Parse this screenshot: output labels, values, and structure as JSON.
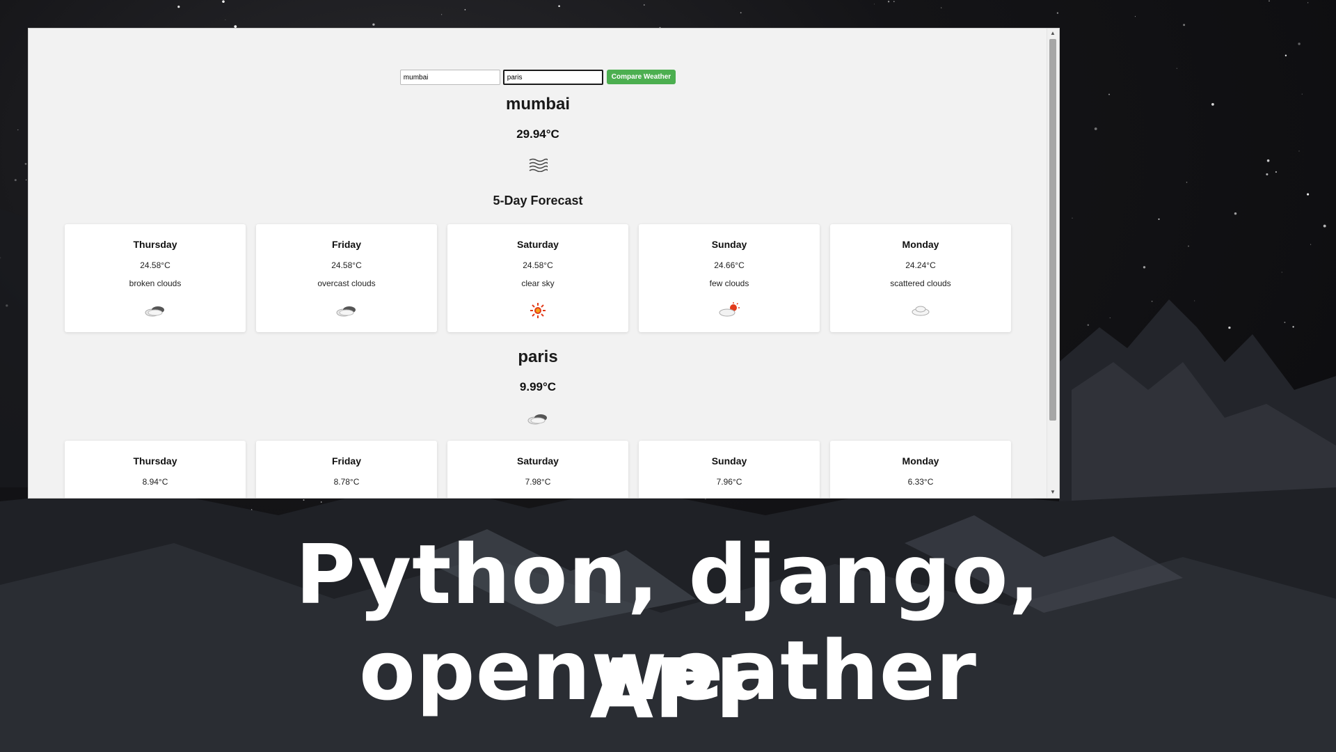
{
  "search": {
    "city1_value": "mumbai",
    "city2_value": "paris",
    "compare_label": "Compare Weather"
  },
  "city1": {
    "name": "mumbai",
    "temp": "29.94°C",
    "icon": "mist-icon",
    "forecast_title": "5-Day Forecast",
    "forecast": [
      {
        "day": "Thursday",
        "temp": "24.58°C",
        "desc": "broken clouds",
        "icon": "broken-clouds-icon"
      },
      {
        "day": "Friday",
        "temp": "24.58°C",
        "desc": "overcast clouds",
        "icon": "overcast-clouds-icon"
      },
      {
        "day": "Saturday",
        "temp": "24.58°C",
        "desc": "clear sky",
        "icon": "sun-icon"
      },
      {
        "day": "Sunday",
        "temp": "24.66°C",
        "desc": "few clouds",
        "icon": "few-clouds-icon"
      },
      {
        "day": "Monday",
        "temp": "24.24°C",
        "desc": "scattered clouds",
        "icon": "scattered-clouds-icon"
      }
    ]
  },
  "city2": {
    "name": "paris",
    "temp": "9.99°C",
    "icon": "broken-clouds-icon",
    "forecast": [
      {
        "day": "Thursday",
        "temp": "8.94°C"
      },
      {
        "day": "Friday",
        "temp": "8.78°C"
      },
      {
        "day": "Saturday",
        "temp": "7.98°C"
      },
      {
        "day": "Sunday",
        "temp": "7.96°C"
      },
      {
        "day": "Monday",
        "temp": "6.33°C"
      }
    ]
  },
  "banner": {
    "line1": "Python, django, openweather",
    "line2": "API"
  },
  "colors": {
    "button": "#4caf50",
    "page_bg": "#f2f2f2",
    "sun": "#e23b1b"
  }
}
